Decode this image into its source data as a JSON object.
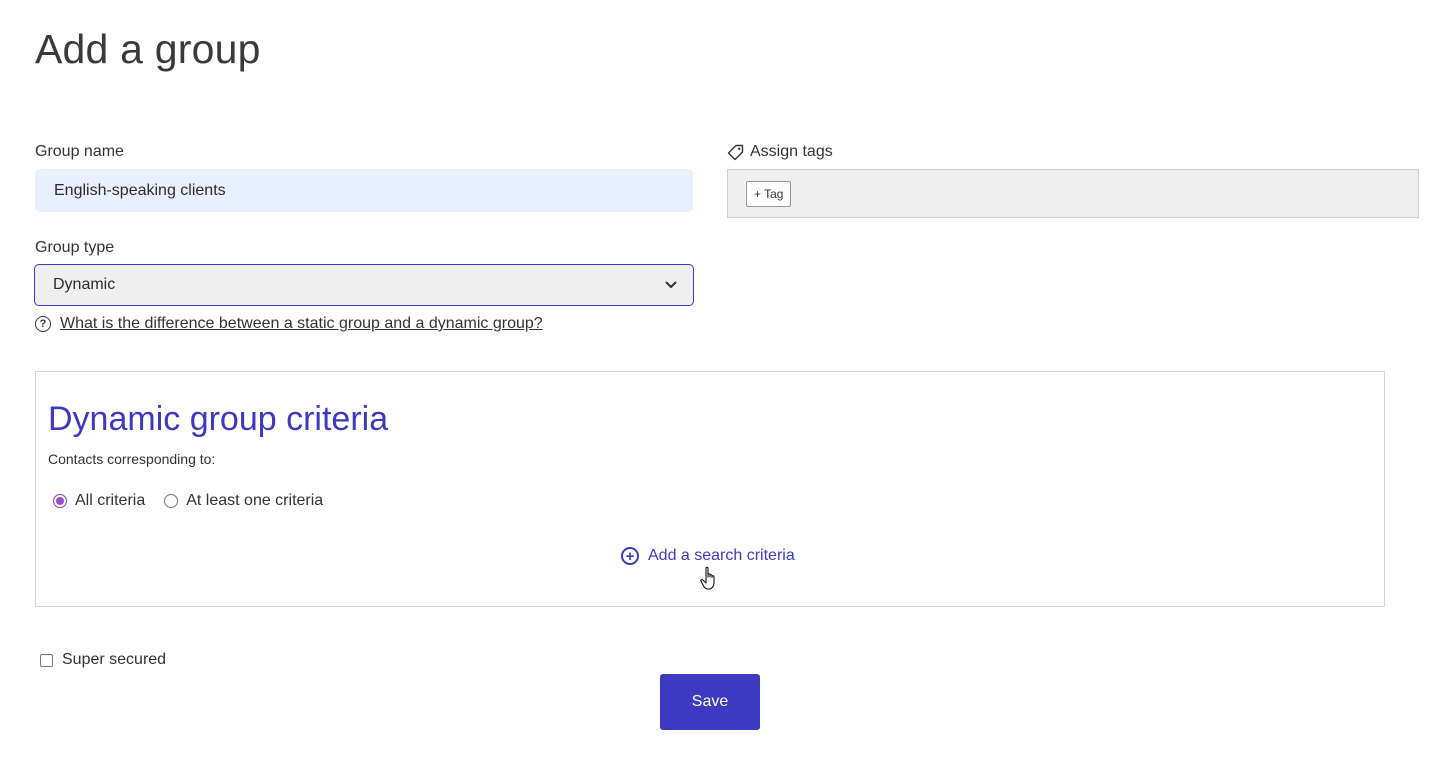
{
  "page": {
    "title": "Add a group"
  },
  "group_name": {
    "label": "Group name",
    "value": "English-speaking clients"
  },
  "tags": {
    "label": "Assign tags",
    "add_tag_label": "+ Tag"
  },
  "group_type": {
    "label": "Group type",
    "selected": "Dynamic",
    "help_link": "What is the difference between a static group and a dynamic group?"
  },
  "criteria": {
    "title": "Dynamic group criteria",
    "subtitle": "Contacts corresponding to:",
    "options": [
      {
        "label": "All criteria",
        "checked": true
      },
      {
        "label": "At least one criteria",
        "checked": false
      }
    ],
    "add_label": "Add a search criteria"
  },
  "super_secured": {
    "label": "Super secured",
    "checked": false
  },
  "save_label": "Save",
  "colors": {
    "accent": "#3d3ac2",
    "radio_checked": "#9b4ccf",
    "input_fill": "#e8f0fe"
  }
}
